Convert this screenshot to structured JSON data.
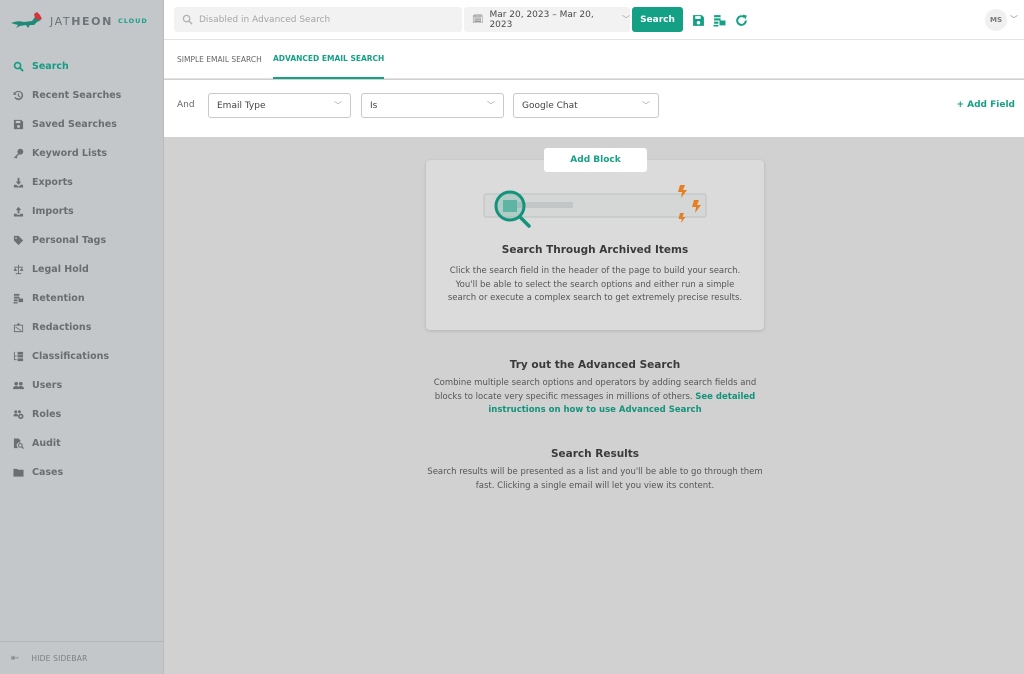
{
  "brand": {
    "name_light": "JAT",
    "name_bold": "HEON",
    "suffix": "CLOUD",
    "accent_color": "#13a085",
    "warning_color": "#e67e22"
  },
  "header": {
    "search_placeholder": "Disabled in Advanced Search",
    "date_range": "Mar 20, 2023 – Mar 20, 2023",
    "search_button": "Search",
    "icons": [
      "save-icon",
      "retention-icon",
      "refresh-icon"
    ],
    "user_initials": "MS"
  },
  "sidebar": {
    "items": [
      {
        "label": "Search",
        "icon": "search-icon",
        "active": true
      },
      {
        "label": "Recent Searches",
        "icon": "history-icon"
      },
      {
        "label": "Saved Searches",
        "icon": "save-icon"
      },
      {
        "label": "Keyword Lists",
        "icon": "key-icon"
      },
      {
        "label": "Exports",
        "icon": "download-icon"
      },
      {
        "label": "Imports",
        "icon": "upload-icon"
      },
      {
        "label": "Personal Tags",
        "icon": "tag-icon"
      },
      {
        "label": "Legal Hold",
        "icon": "scale-icon"
      },
      {
        "label": "Retention",
        "icon": "retention-icon"
      },
      {
        "label": "Redactions",
        "icon": "redaction-icon"
      },
      {
        "label": "Classifications",
        "icon": "classification-icon"
      },
      {
        "label": "Users",
        "icon": "users-icon"
      },
      {
        "label": "Roles",
        "icon": "roles-icon"
      },
      {
        "label": "Audit",
        "icon": "audit-icon"
      },
      {
        "label": "Cases",
        "icon": "folder-icon"
      }
    ],
    "hide_label": "HIDE SIDEBAR"
  },
  "tabs": {
    "simple": "SIMPLE EMAIL SEARCH",
    "advanced": "ADVANCED EMAIL SEARCH",
    "active": "advanced"
  },
  "filter": {
    "operator": "And",
    "field": "Email Type",
    "condition": "Is",
    "value": "Google Chat",
    "add_field": "+ Add Field"
  },
  "main": {
    "add_block": "Add Block",
    "card_title": "Search Through Archived Items",
    "card_desc": "Click the search field in the header of the page to build your search. You'll be able to select the search options and either run a simple search or execute a complex search to get extremely precise results.",
    "advanced_title": "Try out the Advanced Search",
    "advanced_desc": "Combine multiple search options and operators by adding search fields and blocks to locate very specific messages in millions of others.",
    "advanced_link": "See detailed instructions on how to use Advanced Search",
    "results_title": "Search Results",
    "results_desc": "Search results will be presented as a list and you'll be able to go through them fast. Clicking a single email will let you view its content."
  }
}
